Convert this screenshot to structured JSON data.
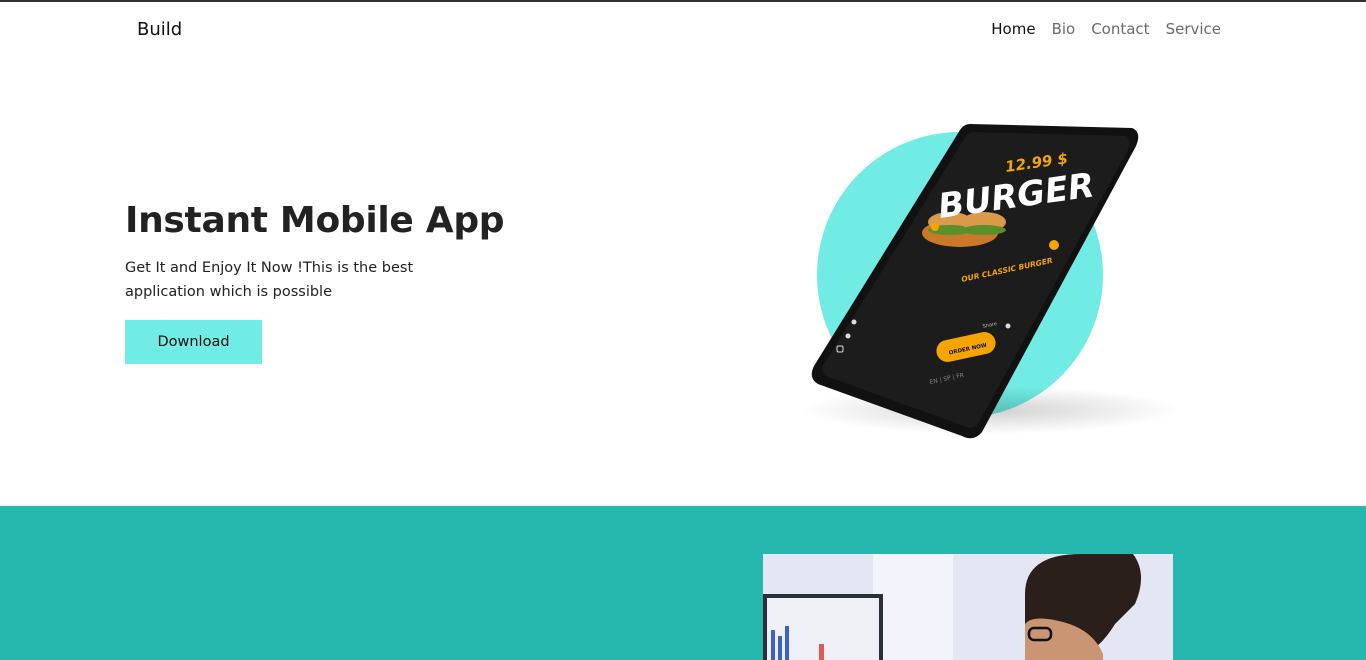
{
  "nav": {
    "brand": "Build",
    "links": [
      {
        "label": "Home",
        "active": true
      },
      {
        "label": "Bio",
        "active": false
      },
      {
        "label": "Contact",
        "active": false
      },
      {
        "label": "Service",
        "active": false
      }
    ]
  },
  "hero": {
    "title": "Instant Mobile App",
    "subtitle": "Get It and Enjoy It Now !This is the best application which is possible",
    "button_label": "Download"
  },
  "phone_screen": {
    "price": "12.99 $",
    "headline": "BURGER",
    "tagline": "OUR CLASSIC BURGER",
    "order_button": "ORDER NOW",
    "share_label": "Share",
    "languages": "EN | SP | FR",
    "icons": [
      "twitter-icon",
      "facebook-icon",
      "instagram-icon",
      "share-icon"
    ]
  },
  "colors": {
    "accent": "#70ece4",
    "teal_section": "#26b8ae",
    "phone_accent": "#f5a400",
    "text": "#222222"
  }
}
